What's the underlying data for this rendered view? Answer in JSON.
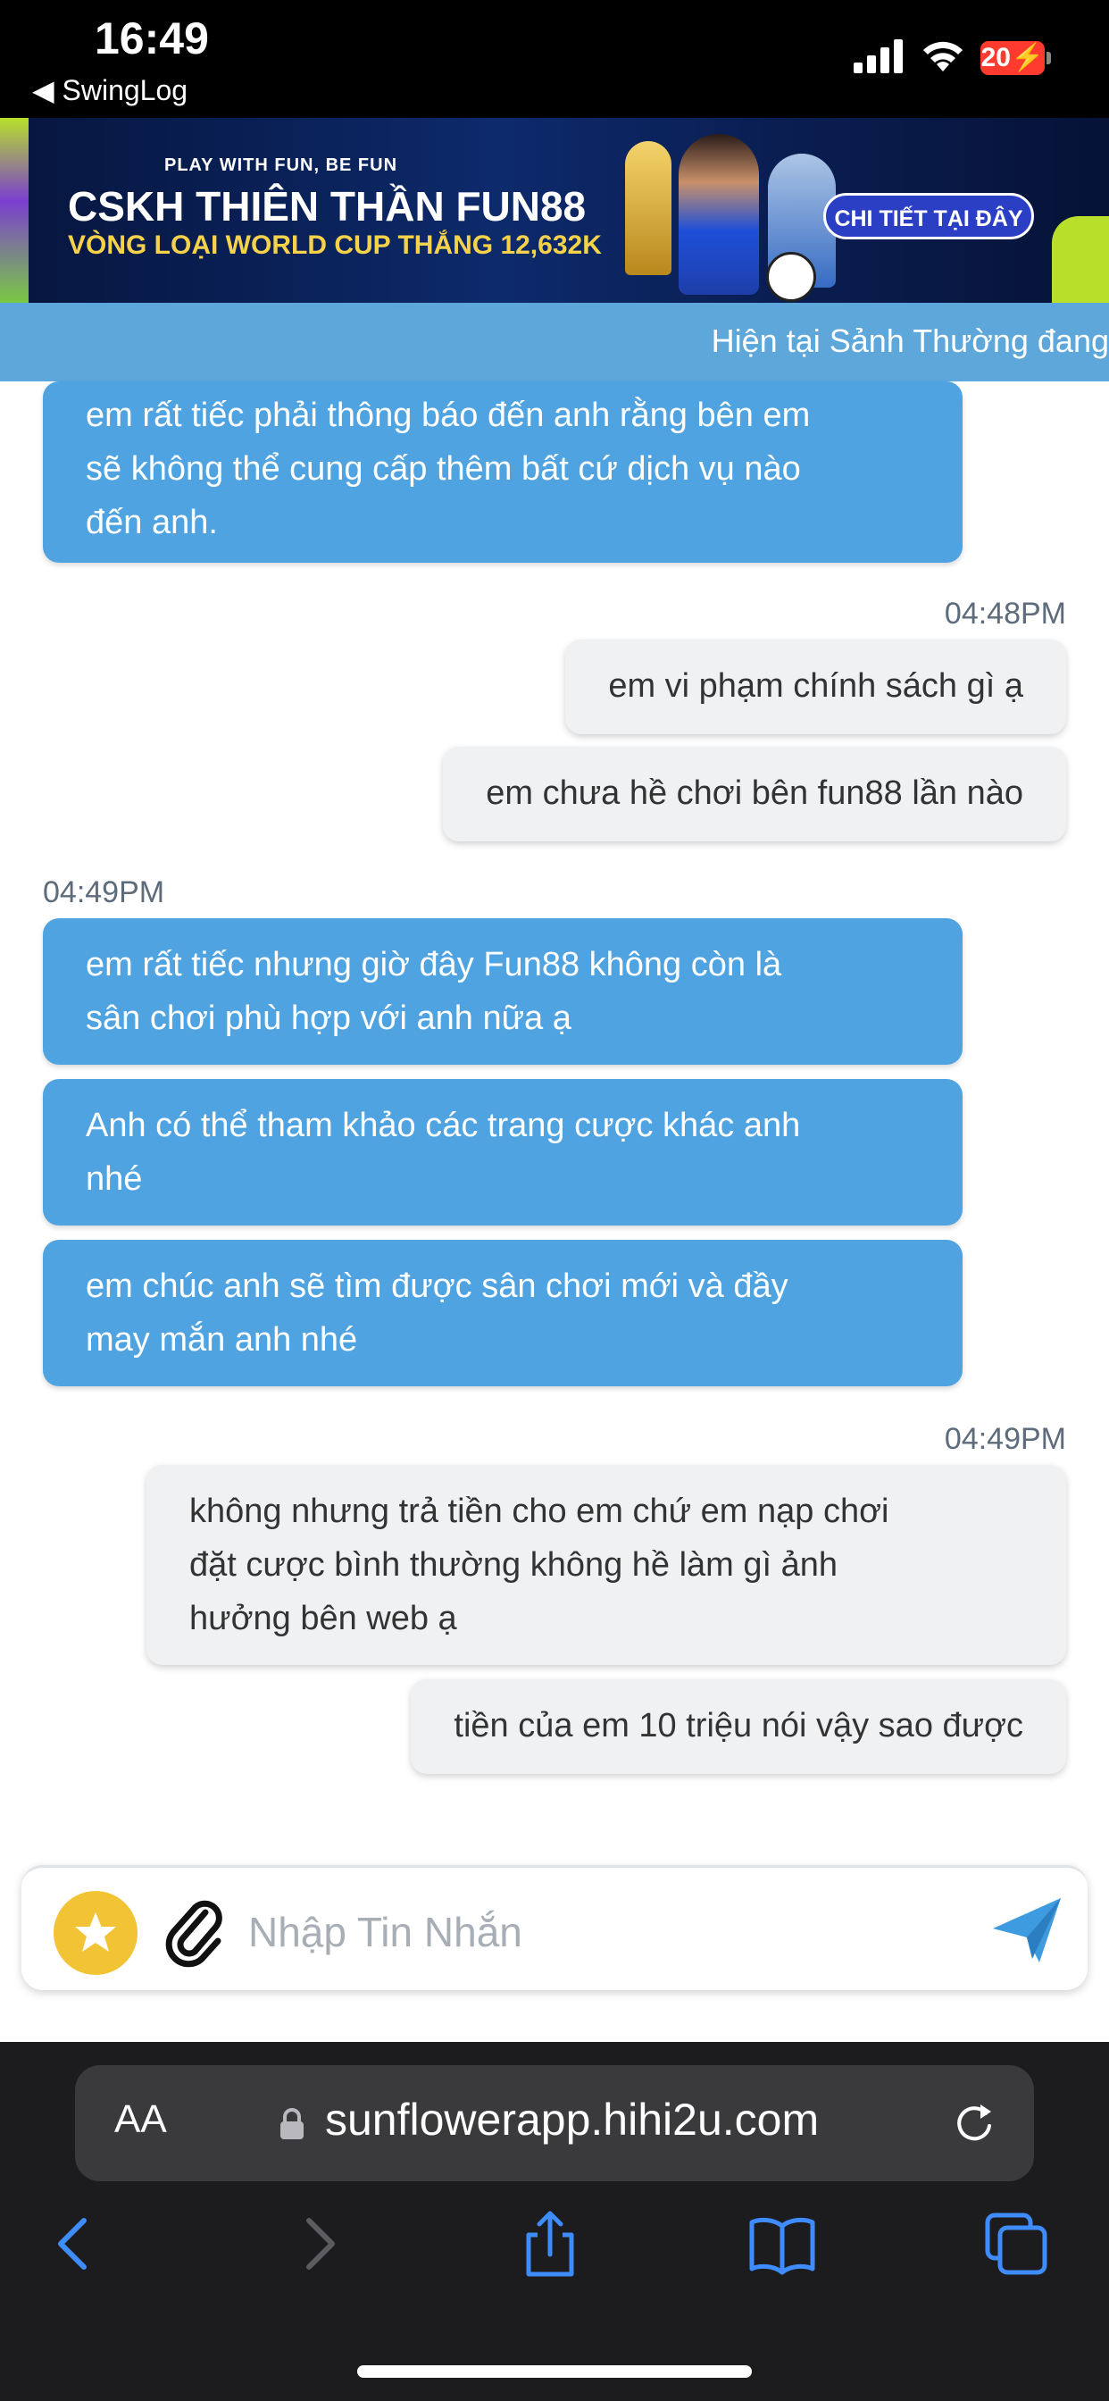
{
  "status_bar": {
    "time": "16:49",
    "back_app": "◀ SwingLog",
    "battery": "20"
  },
  "banner": {
    "tagline": "PLAY WITH FUN, BE FUN",
    "title": "CSKH THIÊN THẦN FUN88",
    "subtitle": "VÒNG LOẠI WORLD CUP THẮNG 12,632K",
    "cta": "CHI TIẾT TẠI ĐÂY"
  },
  "ticker": {
    "text": "Hiện tại Sảnh Thường đang"
  },
  "messages": [
    {
      "from": "agent",
      "lines": [
        "em rất tiếc phải thông báo đến anh rằng bên em",
        "sẽ không thể cung cấp thêm bất cứ dịch vụ nào",
        "đến anh."
      ]
    },
    {
      "time": "04:48PM",
      "from": "user",
      "lines": [
        "em vi phạm chính sách gì ạ"
      ]
    },
    {
      "from": "user",
      "lines": [
        "em chưa hề chơi bên fun88 lần nào"
      ]
    },
    {
      "time": "04:49PM",
      "from": "agent",
      "lines": [
        "em rất tiếc nhưng giờ đây Fun88 không còn là",
        "sân chơi phù hợp với anh nữa ạ"
      ]
    },
    {
      "from": "agent",
      "lines": [
        "Anh có thể tham khảo các trang cược khác anh",
        "nhé"
      ]
    },
    {
      "from": "agent",
      "lines": [
        "em chúc anh sẽ tìm được sân chơi mới và đầy",
        "may mắn anh nhé"
      ]
    },
    {
      "time": "04:49PM",
      "from": "user",
      "lines": [
        "không nhưng trả tiền cho em chứ em nạp chơi",
        "đặt cược bình thường không hề làm gì ảnh",
        "hưởng bên web ạ"
      ]
    },
    {
      "from": "user",
      "lines": [
        "tiền của em 10 triệu nói vậy sao được"
      ]
    }
  ],
  "input": {
    "placeholder": "Nhập Tin Nhắn",
    "value": ""
  },
  "browser": {
    "text_size_label": "AA",
    "url": "sunflowerapp.hihi2u.com"
  },
  "icons": {
    "star": "star-icon",
    "attach": "paperclip-icon",
    "send": "send-icon",
    "lock": "lock-icon",
    "reload": "reload-icon",
    "back": "chevron-left-icon",
    "forward": "chevron-right-icon",
    "share": "share-icon",
    "bookmarks": "book-icon",
    "tabs": "tabs-icon"
  },
  "colors": {
    "agent_bubble": "#4fa3e0",
    "user_bubble": "#eff1f3",
    "ticker": "#5ea7db",
    "star_button": "#f2c335",
    "send": "#3f9be0",
    "browser_chrome": "#1c1c1e"
  }
}
